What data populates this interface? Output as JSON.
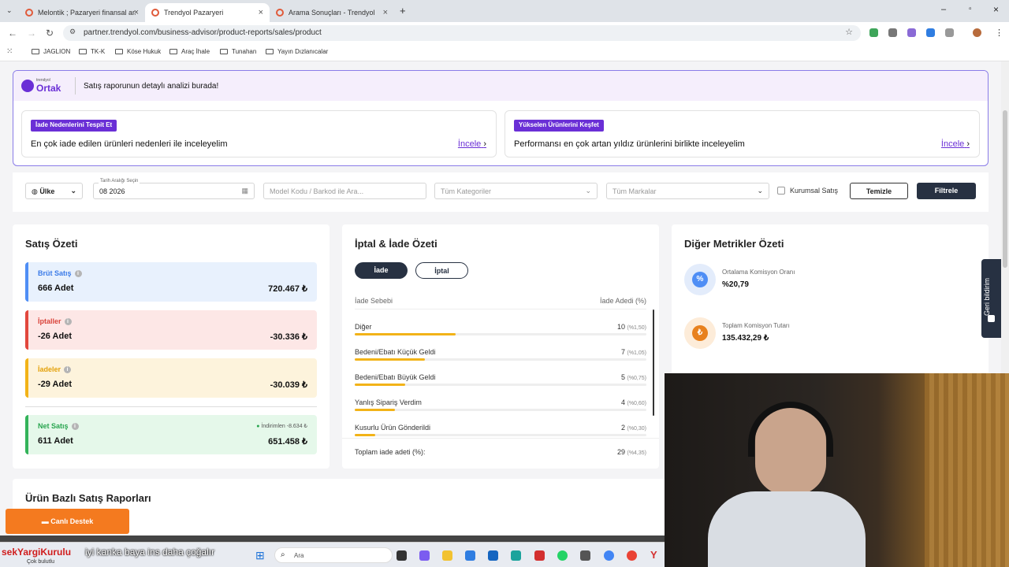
{
  "browser": {
    "tabs": [
      {
        "label": "Melontik ; Pazaryeri finansal ar..."
      },
      {
        "label": "Trendyol Pazaryeri"
      },
      {
        "label": "Arama Sonuçları - Trendyol"
      }
    ],
    "new_tab": "+",
    "url": "partner.trendyol.com/business-advisor/product-reports/sales/product",
    "bookmarks": [
      "JAGLION",
      "TK-K",
      "Köse Hukuk",
      "Araç İhale",
      "Tunahan",
      "Yayın Dızlanıcalar"
    ]
  },
  "banner": {
    "logo_small": "trendyol",
    "logo_big": "Ortak",
    "message": "Satış raporunun detaylı analizi burada!",
    "cards": [
      {
        "tag": "İade Nedenlerini Tespit Et",
        "text": "En çok iade edilen ürünleri nedenleri ile inceleyelim",
        "link": "İncele"
      },
      {
        "tag": "Yükselen Ürünlerini Keşfet",
        "text": "Performansı en çok artan yıldız ürünlerini birlikte inceleyelim",
        "link": "İncele"
      }
    ]
  },
  "filters": {
    "country": "Ülke",
    "date_label": "Tarih Aralığı Seçin",
    "date_value": "08 2026",
    "model_placeholder": "Model Kodu / Barkod ile Ara...",
    "category": "Tüm Kategoriler",
    "brand": "Tüm Markalar",
    "corporate": "Kurumsal Satış",
    "clear": "Temizle",
    "apply": "Filtrele"
  },
  "sales_summary": {
    "title": "Satış Özeti",
    "items": [
      {
        "label": "Brüt Satış",
        "count": "666 Adet",
        "value": "720.467 ₺"
      },
      {
        "label": "İptaller",
        "count": "-26 Adet",
        "value": "-30.336 ₺"
      },
      {
        "label": "İadeler",
        "count": "-29 Adet",
        "value": "-30.039 ₺"
      },
      {
        "label": "Net Satış",
        "count": "611 Adet",
        "value": "651.458 ₺",
        "discount": "İndirimlen -8.634 ₺"
      }
    ]
  },
  "returns_summary": {
    "title": "İptal & İade Özeti",
    "tabs": [
      "İade",
      "İptal"
    ],
    "col_reason": "İade Sebebi",
    "col_count": "İade Adedi (%)",
    "rows": [
      {
        "reason": "Diğer",
        "count": "10",
        "pct": "(%1,50)",
        "share": 0.345
      },
      {
        "reason": "Bedeni/Ebatı Küçük Geldi",
        "count": "7",
        "pct": "(%1,05)",
        "share": 0.241
      },
      {
        "reason": "Bedeni/Ebatı Büyük Geldi",
        "count": "5",
        "pct": "(%0,75)",
        "share": 0.172
      },
      {
        "reason": "Yanlış Sipariş Verdim",
        "count": "4",
        "pct": "(%0,60)",
        "share": 0.138
      },
      {
        "reason": "Kusurlu Ürün Gönderildi",
        "count": "2",
        "pct": "(%0,30)",
        "share": 0.069
      }
    ],
    "total_label": "Toplam iade adeti (%):",
    "total_count": "29",
    "total_pct": "(%4,35)"
  },
  "other_metrics": {
    "title": "Diğer Metrikler Özeti",
    "items": [
      {
        "label": "Ortalama Komisyon Oranı",
        "value": "%20,79",
        "icon": "%"
      },
      {
        "label": "Toplam Komisyon Tutarı",
        "value": "135.432,29 ₺",
        "icon": "₺"
      }
    ]
  },
  "product_reports": {
    "title": "Ürün Bazlı Satış Raporları"
  },
  "feedback": "Geri bildirim",
  "live_support": "Canlı Destek",
  "taskbar": {
    "ticker_name": "sekYargiKurulu",
    "ticker_text": "iyi kanka baya ins daha çoğalır",
    "ticker_sub": "Çok bulutlu",
    "search": "Ara"
  },
  "colors": {
    "brand": "#6a2fd6",
    "dark": "#273142",
    "accent_orange": "#f47a1f"
  }
}
